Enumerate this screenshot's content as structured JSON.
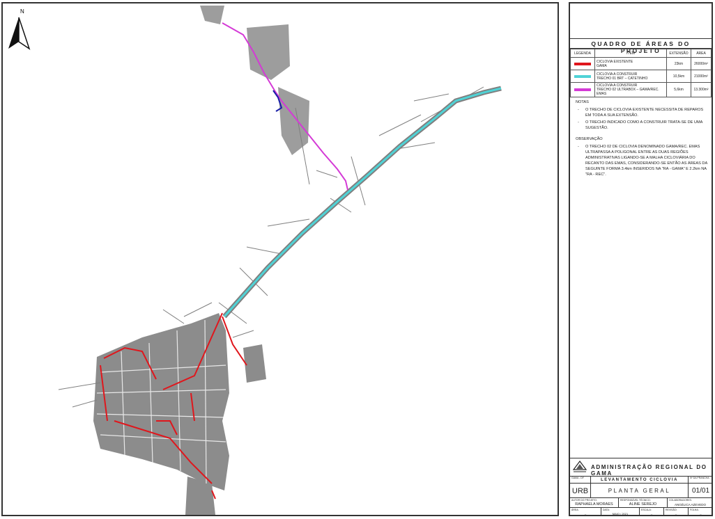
{
  "colors": {
    "existing": "#e0161c",
    "trecho01": "#4fd3d6",
    "trecho02": "#d43ad6",
    "roads": "#7f7f7f",
    "urban": "#8c8c8c",
    "blue_segment": "#1a1fa8"
  },
  "map": {
    "north_label": "N",
    "north_icon": "north-arrow-icon"
  },
  "panel": {
    "title": "QUADRO DE ÁREAS DO PROJETO",
    "headers": [
      "LEGENDA",
      "ITEM",
      "EXTENSÃO",
      "ÁREA"
    ],
    "rows": [
      {
        "item_line1": "CICLOVIA EXISTENTE",
        "item_line2": "GAMA",
        "extension": "23km",
        "area": "26000m²",
        "color": "#e0161c"
      },
      {
        "item_line1": "CICLOVIA A CONSTRUIR",
        "item_line2": "TRECHO 01 BRT – CATETINHO",
        "extension": "10,5km",
        "area": "21000m²",
        "color": "#4fd3d6"
      },
      {
        "item_line1": "CICLOVIA A CONSTRUIR",
        "item_line2": "TRECHO 02 ULTRABOX – GAMA/REC. EMAS",
        "extension": "5,6km",
        "area": "13.300m²",
        "color": "#d43ad6"
      }
    ],
    "notes_heading": "NOTAS",
    "notes": [
      "O TRECHO DE CICLOVIA EXISTENTE NECESSITA DE REPAROS EM TODA A SUA EXTENSÃO.",
      "O TRECHO INDICADO COMO A CONSTRUIR TRATA-SE DE UMA SUGESTÃO."
    ],
    "obs_heading": "OBSERVAÇÃO",
    "observations": [
      "O TRECHO 02 DE CICLOVIA DENOMINADO GAMA/REC. EMAS ULTRAPASSA A POLIGONAL ENTRE AS DUAS REGIÕES ADMINISTRATIVAS LIGANDO-SE A MALHA CICLOVIÁRIA DO RECANTO DAS EMAS, CONSIDERANDO-SE ENTÃO AS ÁREAS DA SEGUINTE FORMA 3.4km INSERIDOS NA \"RA - GAMA\" E 2.2km NA \"RA - REC\"."
    ]
  },
  "titleblock": {
    "org": "ADMINISTRAÇÃO REGIONAL DO GAMA",
    "logo_caption": "GAMA - DF",
    "project": "LEVANTAMENTO CICLOVIA",
    "sheet_label": "Nº DA PRANCHA",
    "code": "URB",
    "plan_title": "PLANTA GERAL",
    "sheet": "01/01",
    "author_label": "AUTOR DO PROJETO:",
    "author": "RAPHAELA MORAES",
    "resp_label": "RESPONSÁVEL TÉCNICO:",
    "resp": "ALINE SEREJO",
    "collab_label": "COLABORADORES:",
    "collab": "ANGÉLICA AZEVEDO",
    "area_label": "ÁREA:",
    "area": "–",
    "date_label": "DATA:",
    "date": "MAIO / 2021",
    "scale_label": "ESCALA:",
    "scale": "–",
    "rev_label": "REVISÃO:",
    "rev": "–",
    "folha_label": "FOLHA:",
    "folha": "–"
  }
}
